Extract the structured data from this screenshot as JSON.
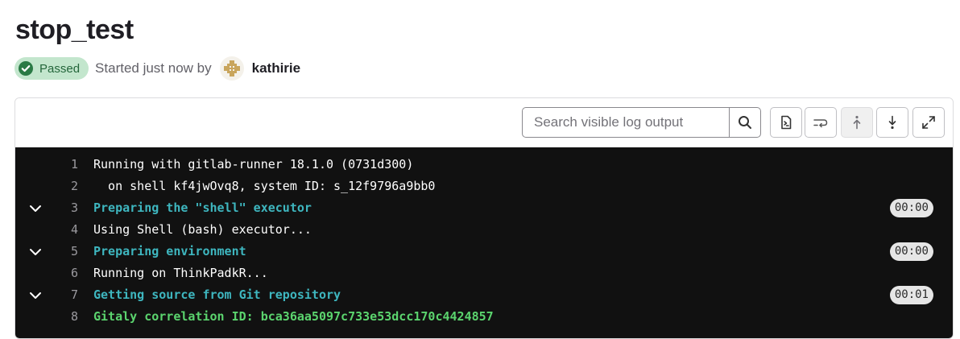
{
  "job": {
    "title": "stop_test",
    "status_label": "Passed",
    "status_color": "#24663b",
    "started_text": "Started just now by",
    "user": "kathirie",
    "avatar_icon": "identicon-avatar"
  },
  "toolbar": {
    "search_placeholder": "Search visible log output",
    "search_icon": "search-icon",
    "buttons": [
      {
        "name": "show-raw-button",
        "icon": "raw-file-icon"
      },
      {
        "name": "wrap-lines-button",
        "icon": "wrap-icon"
      },
      {
        "name": "scroll-to-top-button",
        "icon": "arrow-up-icon"
      },
      {
        "name": "scroll-to-bottom-button",
        "icon": "arrow-down-icon"
      },
      {
        "name": "fullscreen-button",
        "icon": "maximize-icon"
      }
    ]
  },
  "log": {
    "background": "#111111",
    "section_color": "#3eb6bf",
    "lines": [
      {
        "num": "1",
        "text": "Running with gitlab-runner 18.1.0 (0731d300)"
      },
      {
        "num": "2",
        "text": "  on shell kf4jwOvq8, system ID: s_12f9796a9bb0"
      },
      {
        "num": "3",
        "text": "Preparing the \"shell\" executor",
        "duration": "00:00"
      },
      {
        "num": "4",
        "text": "Using Shell (bash) executor..."
      },
      {
        "num": "5",
        "text": "Preparing environment",
        "duration": "00:00"
      },
      {
        "num": "6",
        "text": "Running on ThinkPadkR..."
      },
      {
        "num": "7",
        "text": "Getting source from Git repository",
        "duration": "00:01"
      },
      {
        "num": "8",
        "text": "Gitaly correlation ID: bca36aa5097c733e53dcc170c4424857"
      }
    ]
  }
}
